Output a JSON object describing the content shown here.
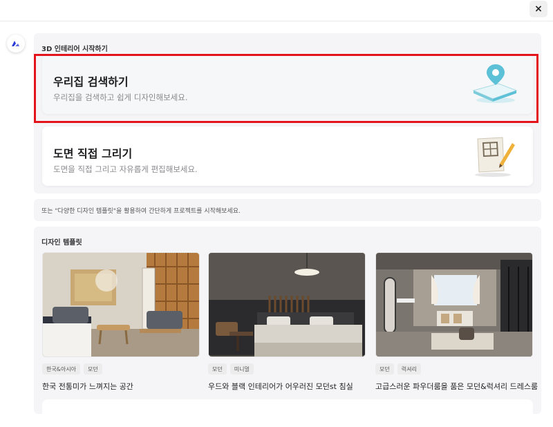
{
  "header": {
    "close_icon": "×"
  },
  "brand": {
    "logo_icon": "logo-icon"
  },
  "start": {
    "title": "3D 인테리어 시작하기",
    "options": [
      {
        "title": "우리집 검색하기",
        "desc": "우리집을 검색하고 쉽게 디자인해보세요.",
        "icon": "map-pin-icon"
      },
      {
        "title": "도면 직접 그리기",
        "desc": "도면을 직접 그리고 자유롭게 편집해보세요.",
        "icon": "floorplan-pencil-icon"
      }
    ]
  },
  "hint": "또는 \"다양한 디자인 템플릿\"을 활용하여 간단하게 프로젝트를 시작해보세요.",
  "templates": {
    "title": "디자인 템플릿",
    "items": [
      {
        "tags": [
          "한국&아시아",
          "모던"
        ],
        "title": "한국 전통미가 느껴지는 공간"
      },
      {
        "tags": [
          "모던",
          "미니멀"
        ],
        "title": "우드와 블랙 인테리어가 어우러진 모던st 침실"
      },
      {
        "tags": [
          "모던",
          "럭셔리"
        ],
        "title": "고급스러운 파우더룸을 품은 모던&럭셔리 드레스룸"
      }
    ]
  },
  "colors": {
    "highlight": "#e3141b",
    "panel": "#f5f5f7",
    "accent": "#2b3bd6",
    "pin": "#5cc0d6"
  }
}
